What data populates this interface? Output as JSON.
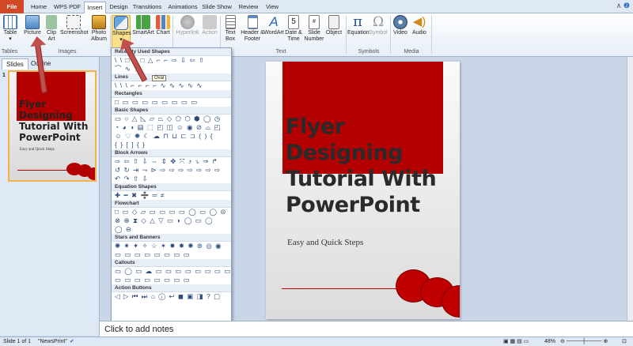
{
  "tabs": [
    "File",
    "Home",
    "WPS PDF",
    "Insert",
    "Design",
    "Transitions",
    "Animations",
    "Slide Show",
    "Review",
    "View"
  ],
  "active_tab": "Insert",
  "ribbon": {
    "table": "Table",
    "picture": "Picture",
    "clip_art": "Clip Art",
    "screenshot": "Screenshot",
    "photo_album": "Photo Album",
    "shapes": "Shapes",
    "smartart": "SmartArt",
    "chart": "Chart",
    "hyperlink": "Hyperlink",
    "action": "Action",
    "text_box": "Text Box",
    "header_footer": "Header & Footer",
    "wordart": "WordArt",
    "date_time": "Date & Time",
    "slide_number": "Slide Number",
    "object": "Object",
    "equation": "Equation",
    "symbol": "Symbol",
    "video": "Video",
    "audio": "Audio",
    "groups": [
      "Tables",
      "Images",
      "Text",
      "Symbols",
      "Media"
    ]
  },
  "left_panel": {
    "tabs": [
      "Slides",
      "Outline"
    ],
    "slide_number": "1"
  },
  "shapes_menu": {
    "sections": [
      {
        "header": "Recently Used Shapes",
        "rows": [
          "\\ \\ □ ○ □ △ ⌐ ⌐ ⇨ ⇩ ⇦ ⇧",
          "⌒ ∿ ☆"
        ]
      },
      {
        "header": "Lines",
        "rows": [
          "\\ \\ \\ ⌐ ⌐ ⌐ ⌐ ∿ ∿ ∿ ∿ ∿"
        ]
      },
      {
        "header": "Rectangles",
        "rows": [
          "□ ▭ ▭ ▭ ▭ ▭ ▭ ▭ ▭"
        ]
      },
      {
        "header": "Basic Shapes",
        "rows": [
          "▭ ○ △ ◺ ▱ ⏢ ◇ ⬠ ⬡ ⬢ ◯ ◷",
          "◔ ◕ ◑ ▤ ⬚ ◰ ◫ ☺ ◉ ⊘ ⌓ ◰",
          "☺ ♡ ✺ ☾ ☁ ⊓ ⊔ ⊏ ⊐ ( ) {",
          "{ } [ ] { }"
        ]
      },
      {
        "header": "Block Arrows",
        "rows": [
          "⇨ ⇦ ⇧ ⇩ ⇔ ⇕ ✥ ⤧ ⤴ ⤵ ⇒ ↱",
          "↺ ↻ ⇥ ⤳ ⊳ ⇨ ⇨ ⇨ ⇨ ⇨ ⇨ ⇨",
          "↶ ↷ ⇧ ⇩"
        ]
      },
      {
        "header": "Equation Shapes",
        "rows": [
          "✚ ━ ✖ ➗ ═ ≠"
        ]
      },
      {
        "header": "Flowchart",
        "rows": [
          "□ ▭ ◇ ▱ ▭ ▭ ▭ ▭ ◯ ▭ ◯ ⊝",
          "⊗ ⊕ ⧗ ◇ △ ▽ ▭ ◗ ◯ ▭ ◯",
          "◯ ⊖"
        ]
      },
      {
        "header": "Stars and Banners",
        "rows": [
          "✺ ✷ ✦ ✧ ☆ ✶ ✹ ✸ ✺ ⊛ ◎ ◉",
          "▭ ▭ ▭ ▭ ▭ ▭ ▭ ▭"
        ]
      },
      {
        "header": "Callouts",
        "rows": [
          "▭ ◯ ▭ ☁ ▭ ▭ ▭ ▭ ▭ ▭ ▭ ▭",
          "▭ ▭ ▭ ▭ ▭ ▭ ▭ ▭"
        ]
      },
      {
        "header": "Action Buttons",
        "rows": [
          "◁ ▷ ⏮ ⏭ ⌂ ⓘ ↩ ◼ ▣ ◨ ? ▢"
        ]
      }
    ],
    "tooltip": "Oval"
  },
  "slide": {
    "title": "Flyer Designing Tutorial With PowerPoint",
    "subtitle": "Easy and Quick Steps"
  },
  "notes_placeholder": "Click to add notes",
  "status": {
    "slide_info": "Slide 1 of 1",
    "theme": "\"NewsPrint\"",
    "zoom": "48%"
  },
  "colors": {
    "accent_red": "#b30000",
    "file_tab": "#d24726",
    "arrow": "#c0504d"
  }
}
